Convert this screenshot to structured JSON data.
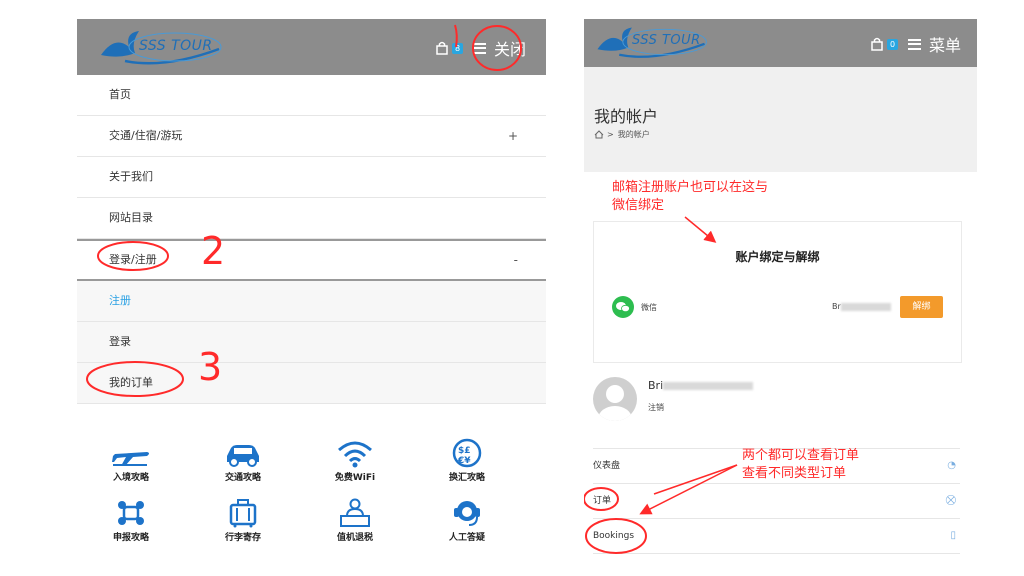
{
  "left_panel": {
    "header": {
      "logo_text": "SSS TOUR",
      "cart_count": "8",
      "menu_label": "关闭"
    },
    "nav_items": [
      {
        "label": "首页",
        "toggle": ""
      },
      {
        "label": "交通/住宿/游玩",
        "toggle": "+"
      },
      {
        "label": "关于我们",
        "toggle": ""
      },
      {
        "label": "网站目录",
        "toggle": ""
      },
      {
        "label": "登录/注册",
        "toggle": "-"
      },
      {
        "label": "注册",
        "toggle": ""
      },
      {
        "label": "登录",
        "toggle": ""
      },
      {
        "label": "我的订单",
        "toggle": ""
      }
    ],
    "quick_links": [
      {
        "label": "入境攻略",
        "icon": "airplane-icon"
      },
      {
        "label": "交通攻略",
        "icon": "car-icon"
      },
      {
        "label": "免费WiFi",
        "icon": "wifi-icon"
      },
      {
        "label": "换汇攻略",
        "icon": "currency-exchange-icon"
      },
      {
        "label": "申报攻略",
        "icon": "declaration-icon"
      },
      {
        "label": "行李寄存",
        "icon": "luggage-icon"
      },
      {
        "label": "值机退税",
        "icon": "checkin-desk-icon"
      },
      {
        "label": "人工答疑",
        "icon": "customer-service-icon"
      }
    ]
  },
  "right_panel": {
    "header": {
      "logo_text": "SSS TOUR",
      "cart_count": "0",
      "menu_label": "菜单"
    },
    "page_title": "我的帐户",
    "breadcrumb": ">",
    "breadcrumb_current": "我的帐户",
    "binding": {
      "title": "账户绑定与解绑",
      "platform": "微信",
      "account_prefix": "Br",
      "unbind_label": "解绑"
    },
    "user": {
      "name_prefix": "Bri",
      "logout_label": "注销"
    },
    "dashboard_items": [
      {
        "label": "仪表盘",
        "icon": "dashboard-icon"
      },
      {
        "label": "订单",
        "icon": "cart-icon"
      },
      {
        "label": "Bookings",
        "icon": "document-icon"
      }
    ]
  },
  "annotations": {
    "num2": "2",
    "num3": "3",
    "email_note_line1": "邮箱注册账户也可以在这与",
    "email_note_line2": "微信绑定",
    "orders_note_line1": "两个都可以查看订单",
    "orders_note_line2": "查看不同类型订单"
  },
  "colors": {
    "header_bg": "#8c8c8c",
    "annotation_red": "#ff2a2a",
    "link_blue": "#2aa1e4",
    "unbind_orange": "#f39a2b",
    "wechat_green": "#2dbd4f",
    "badge_blue": "#29a6e0"
  }
}
